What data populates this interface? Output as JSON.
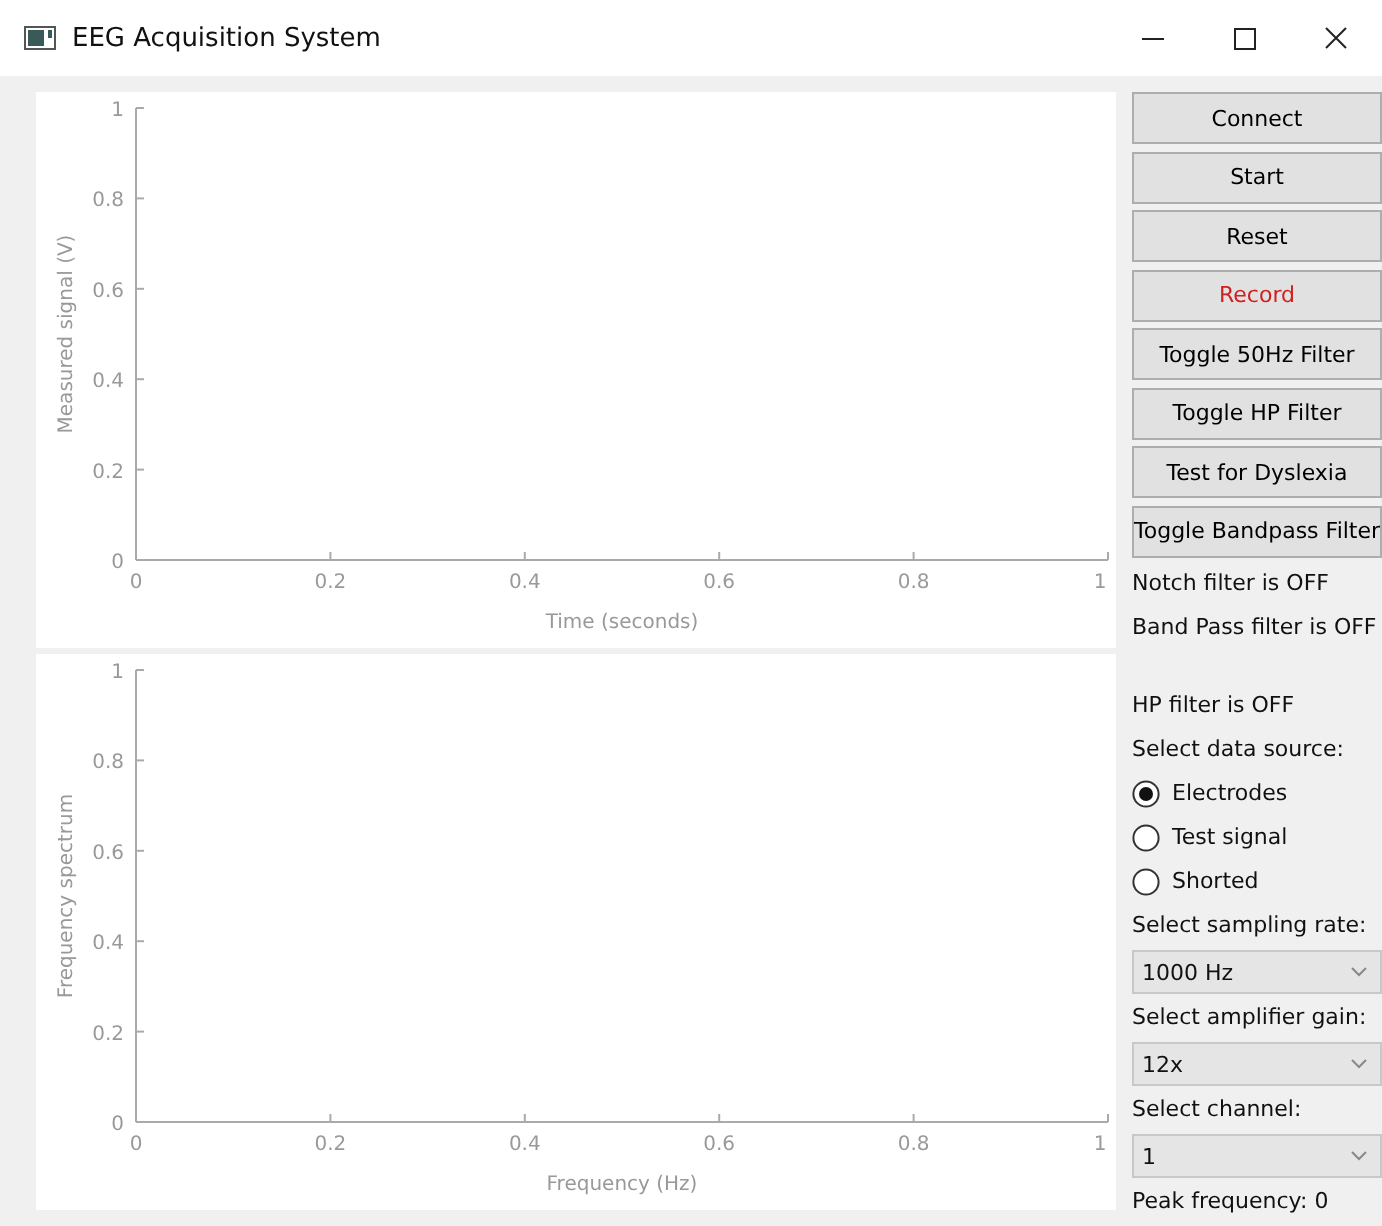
{
  "window": {
    "title": "EEG Acquisition System"
  },
  "charts": [
    {
      "chart_data": {
        "type": "line",
        "xlabel": "Time (seconds)",
        "ylabel": "Measured signal (V)",
        "xlim": [
          0,
          1
        ],
        "ylim": [
          0,
          1
        ],
        "xticks": [
          0,
          0.2,
          0.4,
          0.6,
          0.8,
          1
        ],
        "yticks": [
          0,
          0.2,
          0.4,
          0.6,
          0.8,
          1
        ]
      }
    },
    {
      "chart_data": {
        "type": "line",
        "xlabel": "Frequency (Hz)",
        "ylabel": "Frequency spectrum",
        "xlim": [
          0,
          1
        ],
        "ylim": [
          0,
          1
        ],
        "xticks": [
          0,
          0.2,
          0.4,
          0.6,
          0.8,
          1
        ],
        "yticks": [
          0,
          0.2,
          0.4,
          0.6,
          0.8,
          1
        ]
      }
    }
  ],
  "buttons": [
    {
      "label": "Connect",
      "color": "#000000"
    },
    {
      "label": "Start",
      "color": "#000000"
    },
    {
      "label": "Reset",
      "color": "#000000"
    },
    {
      "label": "Record",
      "color": "#d02020"
    },
    {
      "label": "Toggle 50Hz Filter",
      "color": "#000000"
    },
    {
      "label": "Toggle HP Filter",
      "color": "#000000"
    },
    {
      "label": "Test for Dyslexia",
      "color": "#000000"
    },
    {
      "label": "Toggle Bandpass Filter",
      "color": "#000000"
    }
  ],
  "status": [
    "Notch filter is OFF",
    "Band Pass filter is OFF",
    "HP filter is OFF"
  ],
  "data_source": {
    "label": "Select data source:",
    "options": [
      {
        "label": "Electrodes",
        "selected": true
      },
      {
        "label": "Test signal",
        "selected": false
      },
      {
        "label": "Shorted",
        "selected": false
      }
    ]
  },
  "sampling_rate": {
    "label": "Select sampling rate:",
    "value": "1000 Hz"
  },
  "amplifier_gain": {
    "label": "Select amplifier gain:",
    "value": "12x"
  },
  "channel": {
    "label": "Select channel:",
    "value": "1"
  },
  "peak_frequency": "Peak frequency: 0"
}
